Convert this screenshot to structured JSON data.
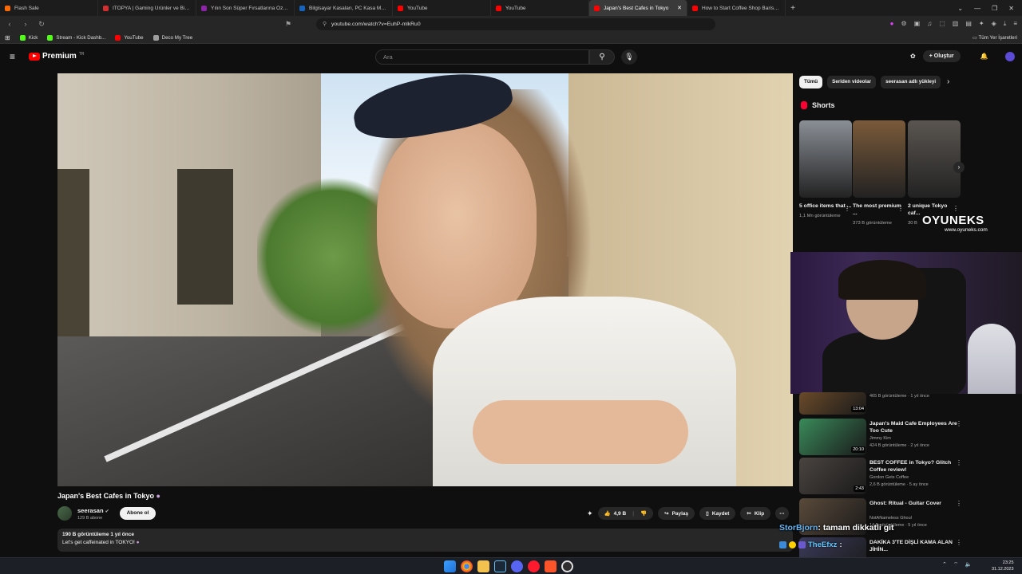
{
  "browser": {
    "tabs": [
      {
        "label": "Flash Sale",
        "color": "#ff6a00",
        "active": false
      },
      {
        "label": "ITOPYA | Gaming Ürünler ve Bilgisay",
        "color": "#d32f2f",
        "active": false
      },
      {
        "label": "Yılın Son Süper Fırsatlarına Özel Bilgi",
        "color": "#8e24aa",
        "active": false
      },
      {
        "label": "Bilgisayar Kasaları, PC Kasa Modelleri",
        "color": "#1565c0",
        "active": false
      },
      {
        "label": "YouTube",
        "color": "#ff0000",
        "active": false
      },
      {
        "label": "YouTube",
        "color": "#ff0000",
        "active": false
      },
      {
        "label": "Japan's Best Cafes in Tokyo",
        "color": "#ff0000",
        "active": true
      },
      {
        "label": "How to Start Coffee Shop Barista Lo",
        "color": "#ff0000",
        "active": false
      }
    ],
    "new_tab": "+",
    "url": "youtube.com/watch?v=EuhP-mlkRu0",
    "bookmarks": [
      {
        "label": "Kick",
        "color": "#53fc18"
      },
      {
        "label": "Stream - Kick Dashb...",
        "color": "#53fc18"
      },
      {
        "label": "YouTube",
        "color": "#ff0000"
      },
      {
        "label": "Deco My Tree",
        "color": "#9e9e9e"
      }
    ],
    "bookmarks_right": "Tüm Yer İşaretleri"
  },
  "yt_header": {
    "logo_word": "Premium",
    "logo_region": "TR",
    "search_placeholder": "Ara",
    "create_label": "Oluştur"
  },
  "video": {
    "title": "Japan's Best Cafes in Tokyo",
    "channel": "seerasan",
    "subscribers": "129 B abone",
    "subscribe_label": "Abone ol",
    "likes": "4,9 B",
    "share_label": "Paylaş",
    "save_label": "Kaydet",
    "clip_label": "Klip",
    "views_line": "190 B görüntüleme   1 yıl önce",
    "description": "Let's get caffeinated in TOKYO!"
  },
  "sidebar": {
    "chips": [
      "Tümü",
      "Seriden videolar",
      "seerasan adlı yükleyi"
    ],
    "shorts_header": "Shorts",
    "shorts": [
      {
        "title": "5 office items that ...",
        "views": "1,1 Mn görüntüleme",
        "color": "#8a8f96"
      },
      {
        "title": "The most premium ...",
        "views": "373 B görüntüleme",
        "color": "#7a5a3a"
      },
      {
        "title": "2 unique Tokyo caf...",
        "views": "30 B",
        "color": "#5a5550"
      }
    ],
    "related": [
      {
        "title": "",
        "channel": "",
        "meta": "465 B görüntüleme · 1 yıl önce",
        "duration": "13:04",
        "color": "#6a4a2a"
      },
      {
        "title": "Japan's Maid Cafe Employees Are Too Cute",
        "channel": "Jimmy Kim",
        "meta": "424 B görüntüleme · 2 yıl önce",
        "duration": "20:10",
        "color": "#3a8a5a"
      },
      {
        "title": "BEST COFFEE in Tokyo? Glitch Coffee review!",
        "channel": "Gordon Gets Coffee",
        "meta": "2,6 B görüntüleme · 5 ay önce",
        "duration": "2:43",
        "color": "#4a4440"
      },
      {
        "title": "Ghost: Ritual - Guitar Cover",
        "channel": "NotANameless Ghoul",
        "meta": "14 B görüntüleme · 5 yıl önce",
        "duration": "",
        "color": "#5a4a3a"
      },
      {
        "title": "DAKİKA 3'TE DİŞLİ KAMA ALAN JİHİN...",
        "channel": "",
        "meta": "",
        "duration": "",
        "color": "#3a3a5a"
      }
    ]
  },
  "overlay": {
    "watermark_main": "OYUNEKS",
    "watermark_sub": "www.oyuneks.com",
    "chat": [
      {
        "user": "StorBjorn",
        "message": ": tamam dikkatli git"
      },
      {
        "user": "TheEfxz",
        "message": ":"
      }
    ]
  },
  "taskbar": {
    "time": "23:25",
    "date": "31.12.2023"
  }
}
